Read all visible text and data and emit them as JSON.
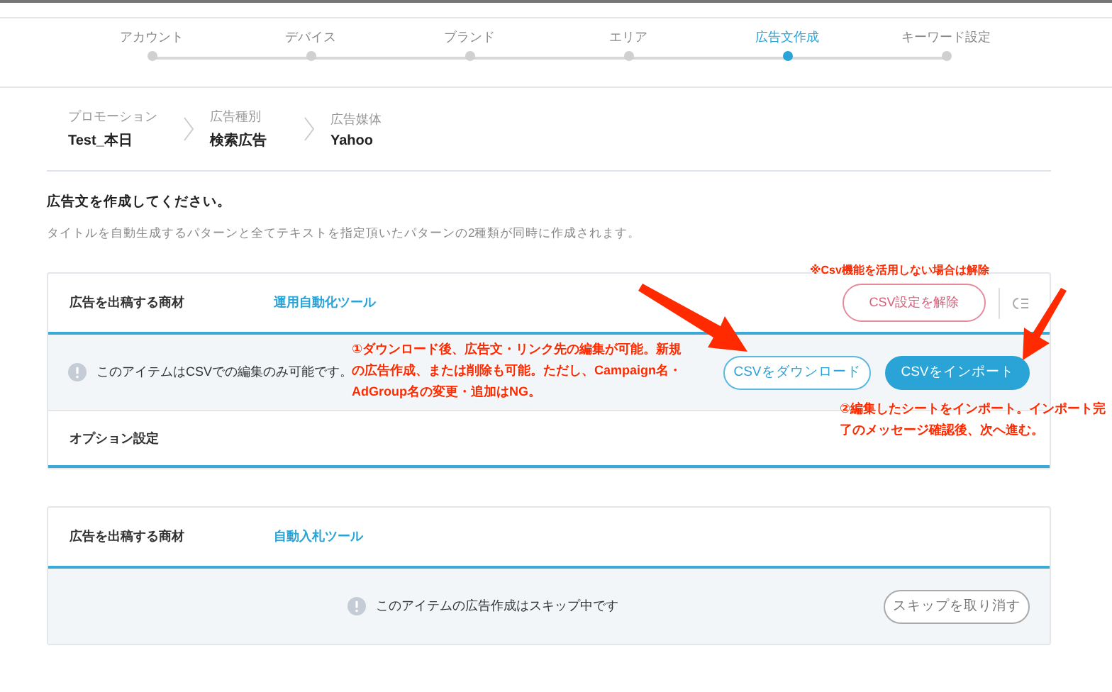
{
  "steps": [
    {
      "label": "アカウント",
      "selected": false
    },
    {
      "label": "デバイス",
      "selected": false
    },
    {
      "label": "ブランド",
      "selected": false
    },
    {
      "label": "エリア",
      "selected": false
    },
    {
      "label": "広告文作成",
      "selected": true
    },
    {
      "label": "キーワード設定",
      "selected": false
    }
  ],
  "breadcrumb": [
    {
      "label": "プロモーション",
      "value": "Test_本日"
    },
    {
      "label": "広告種別",
      "value": "検索広告"
    },
    {
      "label": "広告媒体",
      "value": "Yahoo"
    }
  ],
  "heading": "広告文を作成してください。",
  "description": "タイトルを自動生成するパターンと全てテキストを指定頂いたパターンの2種類が同時に作成されます。",
  "cards": [
    {
      "label": "広告を出稿する商材",
      "link": "運用自動化ツール",
      "header_button": "CSV設定を解除",
      "notice": {
        "text": "このアイテムはCSVでの編集のみ可能です。",
        "kind": "csv_only"
      },
      "buttons": [
        {
          "label": "CSVをダウンロード",
          "kind": "outline"
        },
        {
          "label": "CSVをインポート",
          "kind": "primary"
        }
      ],
      "option": "オプション設定"
    },
    {
      "label": "広告を出稿する商材",
      "link": "自動入札ツール",
      "notice": {
        "text": "このアイテムの広告作成はスキップ中です",
        "kind": "skipped"
      },
      "buttons": [
        {
          "label": "スキップを取り消す",
          "kind": "muted"
        }
      ]
    }
  ],
  "annotations": [
    {
      "lines": [
        "※Csv機能を活用しない場合は解除"
      ]
    },
    {
      "lines": [
        "①ダウンロード後、広告文・リンク先の編集が可能。新規",
        "の広告作成、または削除も可能。ただし、Campaign名・",
        "AdGroup名の変更・追加はNG。"
      ]
    },
    {
      "lines": [
        "②編集したシートをインポート。インポート完",
        "了のメッセージ確認後、次へ進む。"
      ]
    }
  ]
}
